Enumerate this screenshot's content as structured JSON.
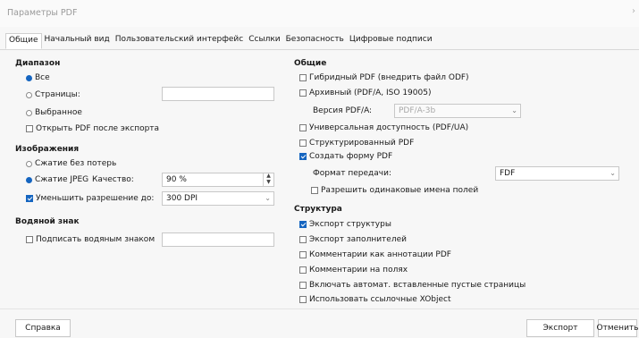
{
  "window": {
    "title": "Параметры PDF",
    "close_glyph": "›"
  },
  "tabs": [
    {
      "label": "Общие"
    },
    {
      "label": "Начальный вид"
    },
    {
      "label": "Пользовательский интерфейс"
    },
    {
      "label": "Ссылки"
    },
    {
      "label": "Безопасность"
    },
    {
      "label": "Цифровые подписи"
    }
  ],
  "left": {
    "range": {
      "heading": "Диапазон",
      "all": "Все",
      "pages": "Страницы:",
      "pages_value": "",
      "selection": "Выбранное",
      "open_after": "Открыть PDF после экспорта"
    },
    "images": {
      "heading": "Изображения",
      "lossless": "Сжатие без потерь",
      "jpeg": "Сжатие JPEG",
      "quality_label": "Качество:",
      "quality_value": "90 %",
      "reduce": "Уменьшить разрешение до:",
      "reduce_value": "300 DPI"
    },
    "watermark": {
      "heading": "Водяной знак",
      "sign": "Подписать водяным знаком",
      "sign_value": ""
    }
  },
  "right": {
    "general": {
      "heading": "Общие",
      "hybrid": "Гибридный PDF (внедрить файл ODF)",
      "archive": "Архивный (PDF/A, ISO 19005)",
      "version_label": "Версия PDF/A:",
      "version_value": "PDF/A-3b",
      "universal": "Универсальная доступность (PDF/UA)",
      "structured": "Структурированный PDF",
      "create_form": "Создать форму PDF",
      "format_label": "Формат передачи:",
      "format_value": "FDF",
      "allow_dup": "Разрешить одинаковые имена полей"
    },
    "structure": {
      "heading": "Структура",
      "export_outline": "Экспорт структуры",
      "export_placeholders": "Экспорт заполнителей",
      "comments_annotations": "Комментарии как аннотации PDF",
      "comments_margin": "Комментарии на полях",
      "include_blank": "Включать автомат. вставленные пустые страницы",
      "use_xobject": "Использовать ссылочные XObject"
    }
  },
  "buttons": {
    "help": "Справка",
    "export": "Экспорт",
    "cancel": "Отменить"
  },
  "icons": {
    "dropdown": "chevron-down-icon",
    "spinner_up": "▲",
    "spinner_down": "▼",
    "dropdown_glyph": "⌄"
  },
  "colors": {
    "accent": "#1565c0"
  }
}
